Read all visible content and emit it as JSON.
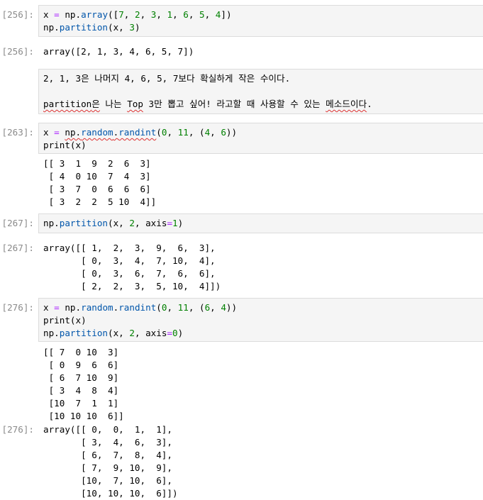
{
  "cells": {
    "c256_in": {
      "prompt": "[256]:",
      "lines": [
        [
          {
            "t": "x "
          },
          {
            "t": "=",
            "c": "op"
          },
          {
            "t": " np."
          },
          {
            "t": "array",
            "c": "fn"
          },
          {
            "t": "(["
          },
          {
            "t": "7",
            "c": "nm"
          },
          {
            "t": ", "
          },
          {
            "t": "2",
            "c": "nm"
          },
          {
            "t": ", "
          },
          {
            "t": "3",
            "c": "nm"
          },
          {
            "t": ", "
          },
          {
            "t": "1",
            "c": "nm"
          },
          {
            "t": ", "
          },
          {
            "t": "6",
            "c": "nm"
          },
          {
            "t": ", "
          },
          {
            "t": "5",
            "c": "nm"
          },
          {
            "t": ", "
          },
          {
            "t": "4",
            "c": "nm"
          },
          {
            "t": "])"
          }
        ],
        [
          {
            "t": "np."
          },
          {
            "t": "partition",
            "c": "fn"
          },
          {
            "t": "(x, "
          },
          {
            "t": "3",
            "c": "nm"
          },
          {
            "t": ")"
          }
        ]
      ]
    },
    "c256_out": {
      "prompt": "[256]:",
      "text": "array([2, 1, 3, 4, 6, 5, 7])"
    },
    "markdown": {
      "line1": "2, 1, 3은 나머지 4, 6, 5, 7보다 확실하게 작은 수이다.",
      "line2": [
        {
          "t": "partition",
          "sq": true
        },
        {
          "t": "은",
          "sq": true
        },
        {
          "t": " 나는 "
        },
        {
          "t": "Top",
          "sq": true
        },
        {
          "t": " 3만 뽑고 싶어! 라고할 때 사용할 수 있는 "
        },
        {
          "t": "메소드이다",
          "sq": true
        },
        {
          "t": "."
        }
      ]
    },
    "c263_in": {
      "prompt": "[263]:",
      "lines": [
        [
          {
            "t": "x "
          },
          {
            "t": "=",
            "c": "op"
          },
          {
            "t": " "
          },
          {
            "t": "np.",
            "sq": true
          },
          {
            "t": "random",
            "c": "fn",
            "sq": true
          },
          {
            "t": ".",
            "sq": true
          },
          {
            "t": "randint",
            "c": "fn",
            "sq": true
          },
          {
            "t": "("
          },
          {
            "t": "0",
            "c": "nm"
          },
          {
            "t": ", "
          },
          {
            "t": "11",
            "c": "nm"
          },
          {
            "t": ", ("
          },
          {
            "t": "4",
            "c": "nm"
          },
          {
            "t": ", "
          },
          {
            "t": "6",
            "c": "nm"
          },
          {
            "t": "))"
          }
        ],
        [
          {
            "t": "print("
          },
          {
            "t": "x"
          },
          {
            "t": ")"
          }
        ]
      ]
    },
    "c263_out": {
      "text": "[[ 3  1  9  2  6  3]\n [ 4  0 10  7  4  3]\n [ 3  7  0  6  6  6]\n [ 3  2  2  5 10  4]]"
    },
    "c267_in": {
      "prompt": "[267]:",
      "lines": [
        [
          {
            "t": "np."
          },
          {
            "t": "partition",
            "c": "fn"
          },
          {
            "t": "(x, "
          },
          {
            "t": "2",
            "c": "nm"
          },
          {
            "t": ", axis"
          },
          {
            "t": "=",
            "c": "op"
          },
          {
            "t": "1",
            "c": "nm"
          },
          {
            "t": ")"
          }
        ]
      ]
    },
    "c267_out": {
      "prompt": "[267]:",
      "text": "array([[ 1,  2,  3,  9,  6,  3],\n       [ 0,  3,  4,  7, 10,  4],\n       [ 0,  3,  6,  7,  6,  6],\n       [ 2,  2,  3,  5, 10,  4]])"
    },
    "c276_in": {
      "prompt": "[276]:",
      "lines": [
        [
          {
            "t": "x "
          },
          {
            "t": "=",
            "c": "op"
          },
          {
            "t": " np."
          },
          {
            "t": "random",
            "c": "fn"
          },
          {
            "t": "."
          },
          {
            "t": "randint",
            "c": "fn"
          },
          {
            "t": "("
          },
          {
            "t": "0",
            "c": "nm"
          },
          {
            "t": ", "
          },
          {
            "t": "11",
            "c": "nm"
          },
          {
            "t": ", ("
          },
          {
            "t": "6",
            "c": "nm"
          },
          {
            "t": ", "
          },
          {
            "t": "4",
            "c": "nm"
          },
          {
            "t": "))"
          }
        ],
        [
          {
            "t": "print(x)"
          }
        ],
        [
          {
            "t": "np."
          },
          {
            "t": "partition",
            "c": "fn"
          },
          {
            "t": "(x, "
          },
          {
            "t": "2",
            "c": "nm"
          },
          {
            "t": ", axis"
          },
          {
            "t": "=",
            "c": "op"
          },
          {
            "t": "0",
            "c": "nm"
          },
          {
            "t": ")"
          }
        ]
      ]
    },
    "c276_print": {
      "text": "[[ 7  0 10  3]\n [ 0  9  6  6]\n [ 6  7 10  9]\n [ 3  4  8  4]\n [10  7  1  1]\n [10 10 10  6]]"
    },
    "c276_out": {
      "prompt": "[276]:",
      "text": "array([[ 0,  0,  1,  1],\n       [ 3,  4,  6,  3],\n       [ 6,  7,  8,  4],\n       [ 7,  9, 10,  9],\n       [10,  7, 10,  6],\n       [10, 10, 10,  6]])"
    }
  },
  "colors": {
    "number": "#008000",
    "function": "#0055aa",
    "operator": "#aa22ff",
    "prompt": "#8a8a8a",
    "cell_bg": "#f5f5f5",
    "cell_border": "#dcdcdc",
    "spell_underline": "#d33"
  }
}
